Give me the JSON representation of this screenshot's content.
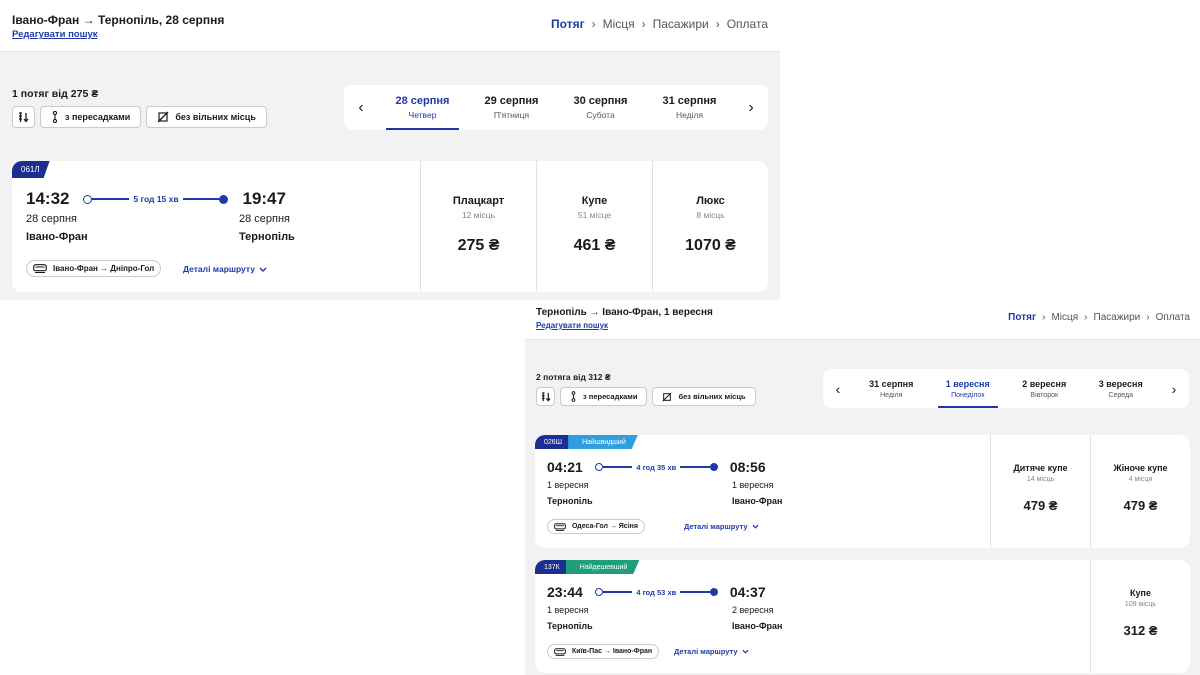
{
  "panel1": {
    "route_title": "Івано-Фран → Тернопіль, 28 серпня",
    "edit_label": "Редагувати пошук",
    "steps": [
      "Потяг",
      "Місця",
      "Пасажири",
      "Оплата"
    ],
    "found": "1 потяг від 275 ₴",
    "filters": {
      "transfers": "з пересадками",
      "no_seats": "без вільних місць"
    },
    "dates": [
      {
        "date": "28 серпня",
        "weekday": "Четвер",
        "active": true
      },
      {
        "date": "29 серпня",
        "weekday": "П'ятниця",
        "active": false
      },
      {
        "date": "30 серпня",
        "weekday": "Субота",
        "active": false
      },
      {
        "date": "31 серпня",
        "weekday": "Неділя",
        "active": false
      }
    ],
    "trains": [
      {
        "number": "061Л",
        "depart_time": "14:32",
        "arrive_time": "19:47",
        "duration": "5 год 15 хв",
        "depart_date": "28 серпня",
        "arrive_date": "28 серпня",
        "depart_station": "Івано-Фран",
        "arrive_station": "Тернопіль",
        "route": "Івано-Фран → Дніпро-Гол",
        "details_label": "Деталі маршруту",
        "classes": [
          {
            "name": "Плацкарт",
            "seats": "12 місць",
            "price": "275 ₴"
          },
          {
            "name": "Купе",
            "seats": "51 місце",
            "price": "461 ₴"
          },
          {
            "name": "Люкс",
            "seats": "8 місць",
            "price": "1070 ₴"
          }
        ]
      }
    ]
  },
  "panel2": {
    "route_title": "Тернопіль → Івано-Фран, 1 вересня",
    "edit_label": "Редагувати пошук",
    "steps": [
      "Потяг",
      "Місця",
      "Пасажири",
      "Оплата"
    ],
    "found": "2 потяга від 312 ₴",
    "filters": {
      "transfers": "з пересадками",
      "no_seats": "без вільних місць"
    },
    "dates": [
      {
        "date": "31 серпня",
        "weekday": "Неділя",
        "active": false
      },
      {
        "date": "1 вересня",
        "weekday": "Понеділок",
        "active": true
      },
      {
        "date": "2 вересня",
        "weekday": "Вівторок",
        "active": false
      },
      {
        "date": "3 вересня",
        "weekday": "Середа",
        "active": false
      }
    ],
    "trains": [
      {
        "number": "026Ш",
        "badge": "Найшвидший",
        "depart_time": "04:21",
        "arrive_time": "08:56",
        "duration": "4 год 35 хв",
        "depart_date": "1 вересня",
        "arrive_date": "1 вересня",
        "depart_station": "Тернопіль",
        "arrive_station": "Івано-Фран",
        "route": "Одеса-Гол → Ясіня",
        "details_label": "Деталі маршруту",
        "classes": [
          {
            "name": "Дитяче купе",
            "seats": "14 місць",
            "price": "479 ₴"
          },
          {
            "name": "Жіноче купе",
            "seats": "4 місця",
            "price": "479 ₴"
          }
        ]
      },
      {
        "number": "137К",
        "badge": "Найдешевший",
        "depart_time": "23:44",
        "arrive_time": "04:37",
        "duration": "4 год 53 хв",
        "depart_date": "1 вересня",
        "arrive_date": "2 вересня",
        "depart_station": "Тернопіль",
        "arrive_station": "Івано-Фран",
        "route": "Київ-Пас → Івано-Фран",
        "details_label": "Деталі маршруту",
        "classes": [
          {
            "name": "Купе",
            "seats": "109 місць",
            "price": "312 ₴"
          }
        ]
      }
    ]
  },
  "colors": {
    "accent": "#1f3aa8",
    "train_tag": "#1a2f8f",
    "fastest_tag": "#2f9fe0",
    "cheapest_tag": "#1e9f7a",
    "background": "#f2f2f5"
  }
}
